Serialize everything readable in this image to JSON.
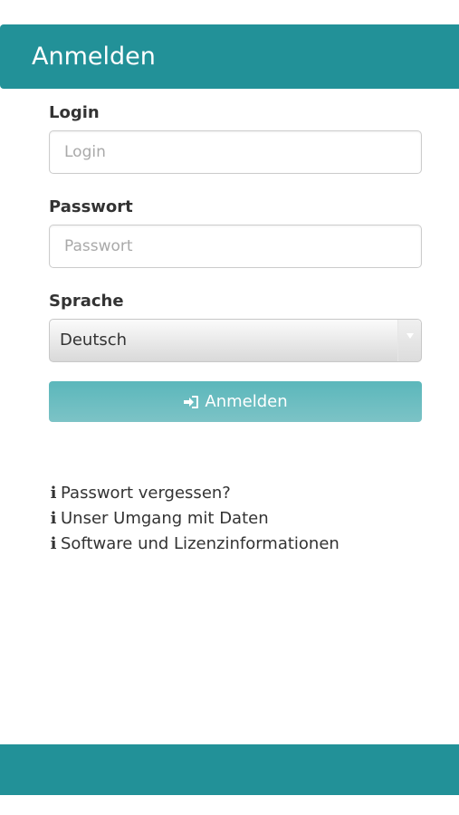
{
  "header": {
    "title": "Anmelden"
  },
  "form": {
    "login": {
      "label": "Login",
      "placeholder": "Login",
      "value": ""
    },
    "password": {
      "label": "Passwort",
      "placeholder": "Passwort",
      "value": ""
    },
    "language": {
      "label": "Sprache",
      "selected": "Deutsch"
    },
    "submit": {
      "label": "Anmelden",
      "icon": "sign-in-icon"
    }
  },
  "links": [
    {
      "icon": "info-icon",
      "text": "Passwort vergessen?"
    },
    {
      "icon": "info-icon",
      "text": "Unser Umgang mit Daten"
    },
    {
      "icon": "info-icon",
      "text": "Software und Lizenzinformationen"
    }
  ],
  "colors": {
    "brand": "#229198",
    "button": "#6bbdc0",
    "text": "#333333"
  }
}
